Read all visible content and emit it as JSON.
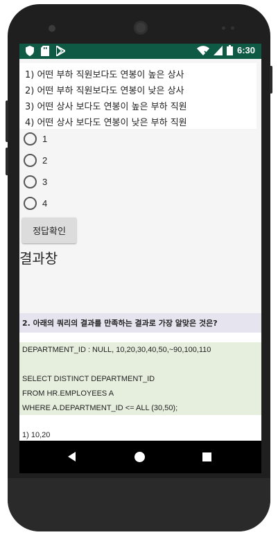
{
  "status_bar": {
    "time": "6:30",
    "left_icons": [
      "shield-icon",
      "sd-card-icon",
      "play-store-icon"
    ],
    "right_icons": [
      "wifi-icon",
      "signal-icon",
      "battery-icon"
    ]
  },
  "quiz1": {
    "options_text": [
      "1) 어떤 부하 직원보다도 연봉이 높은 상사",
      "2) 어떤 부하 직원보다도 연봉이 낮은 상사",
      "3) 어떤 상사 보다도 연봉이 높은 부하 직원",
      "4) 어떤 상사 보다도 연봉이 낮은 부하 직원"
    ],
    "radio_options": [
      "1",
      "2",
      "3",
      "4"
    ],
    "check_button": "정답확인",
    "result_title": "결과창"
  },
  "quiz2": {
    "question": "2. 아래의 쿼리의 결과를 만족하는 결과로 가장 알맞은 것은?",
    "code_lines": [
      "DEPARTMENT_ID : NULL, 10,20,30,40,50,~90,100,110",
      "",
      "SELECT DISTINCT DEPARTMENT_ID",
      "FROM HR.EMPLOYEES A",
      "WHERE A.DEPARTMENT_ID <= ALL (30,50);"
    ],
    "first_answer": "1) 10,20"
  },
  "colors": {
    "status_bar": "#0e5a45",
    "question_bg": "#e6e4ef",
    "code_bg": "#e6eedd"
  },
  "nav_icons": [
    "back-icon",
    "home-icon",
    "recent-apps-icon"
  ]
}
